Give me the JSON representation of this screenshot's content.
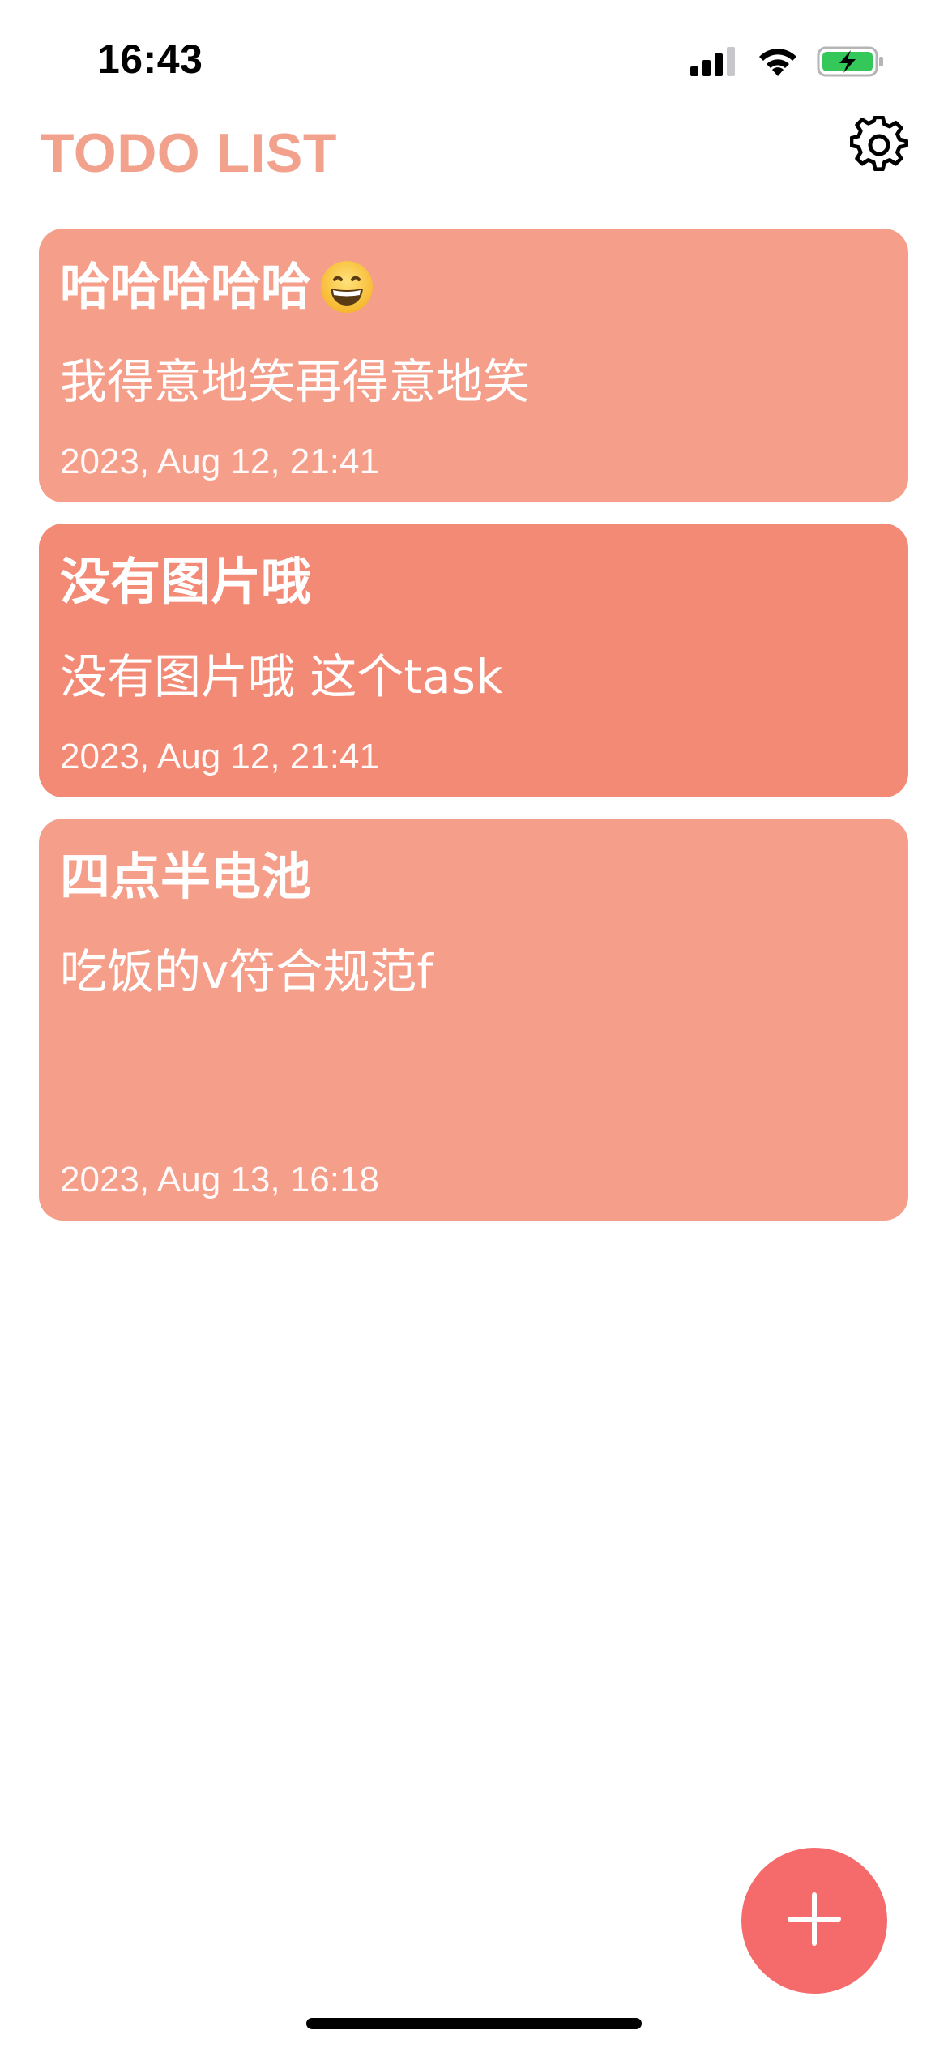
{
  "status_bar": {
    "time": "16:43"
  },
  "header": {
    "title": "TODO LIST",
    "settings_icon": "gear-icon"
  },
  "colors": {
    "title": "#f2a18c",
    "card_default": "#f59e8a",
    "card_highlight": "#f38a75",
    "fab": "#f56b6b",
    "battery_fill": "#34c759"
  },
  "tasks": [
    {
      "title": "哈哈哈哈哈",
      "emoji": "grinning-face-icon",
      "description": "我得意地笑再得意地笑",
      "date": "2023, Aug 12, 21:41"
    },
    {
      "title": "没有图片哦",
      "description": "没有图片哦 这个task",
      "date": "2023, Aug 12, 21:41"
    },
    {
      "title": "四点半电池",
      "description": "吃饭的v符合规范f",
      "date": "2023, Aug 13, 16:18"
    }
  ],
  "fab": {
    "icon": "plus-icon"
  }
}
